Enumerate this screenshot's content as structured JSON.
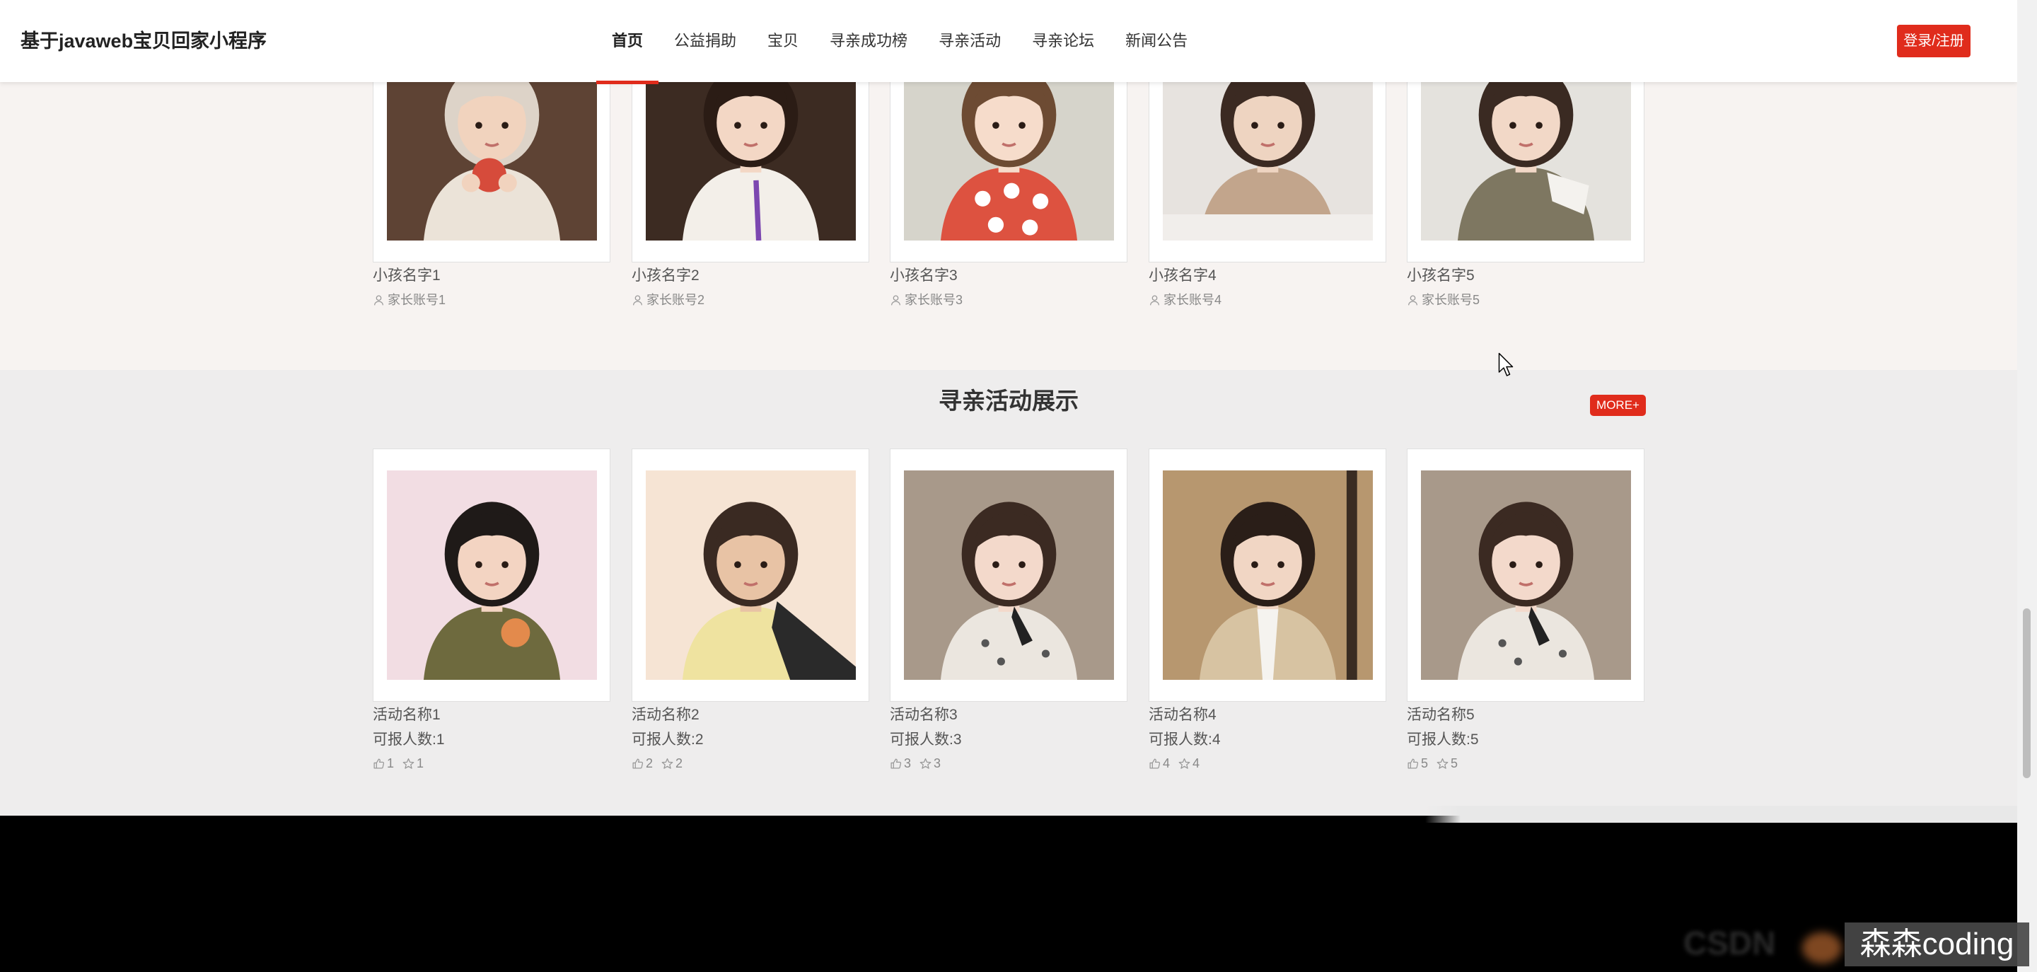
{
  "colors": {
    "accent": "#e02c1c"
  },
  "header": {
    "site_title": "基于javaweb宝贝回家小程序",
    "nav": [
      {
        "label": "首页",
        "active": true
      },
      {
        "label": "公益捐助",
        "active": false
      },
      {
        "label": "宝贝",
        "active": false
      },
      {
        "label": "寻亲成功榜",
        "active": false
      },
      {
        "label": "寻亲活动",
        "active": false
      },
      {
        "label": "寻亲论坛",
        "active": false
      },
      {
        "label": "新闻公告",
        "active": false
      }
    ],
    "login_label": "登录/注册"
  },
  "children": [
    {
      "name": "小孩名字1",
      "parent_account": "家长账号1"
    },
    {
      "name": "小孩名字2",
      "parent_account": "家长账号2"
    },
    {
      "name": "小孩名字3",
      "parent_account": "家长账号3"
    },
    {
      "name": "小孩名字4",
      "parent_account": "家长账号4"
    },
    {
      "name": "小孩名字5",
      "parent_account": "家长账号5"
    }
  ],
  "activities": {
    "title": "寻亲活动展示",
    "more_label": "MORE+",
    "capacity_prefix": "可报人数:",
    "items": [
      {
        "name": "活动名称1",
        "capacity": 1,
        "likes": 1,
        "favorites": 1
      },
      {
        "name": "活动名称2",
        "capacity": 2,
        "likes": 2,
        "favorites": 2
      },
      {
        "name": "活动名称3",
        "capacity": 3,
        "likes": 3,
        "favorites": 3
      },
      {
        "name": "活动名称4",
        "capacity": 4,
        "likes": 4,
        "favorites": 4
      },
      {
        "name": "活动名称5",
        "capacity": 5,
        "likes": 5,
        "favorites": 5
      }
    ]
  },
  "watermark": {
    "text": "森森coding",
    "faint_text": "CSDN"
  }
}
